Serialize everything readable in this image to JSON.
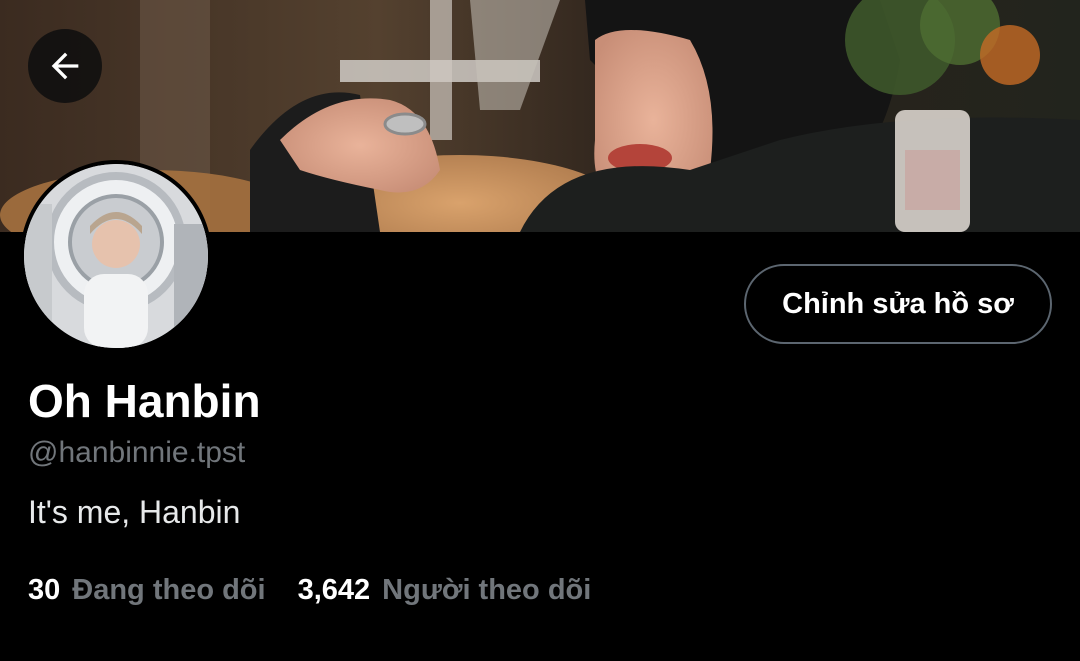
{
  "header": {
    "back_icon": "arrow-left-icon"
  },
  "profile": {
    "edit_label": "Chỉnh sửa hồ sơ",
    "display_name": "Oh Hanbin",
    "handle": "@hanbinnie.tpst",
    "bio": "It's me, Hanbin",
    "following_count": "30",
    "following_label": "Đang theo dõi",
    "followers_count": "3,642",
    "followers_label": "Người theo dõi"
  },
  "colors": {
    "background": "#000000",
    "secondary_text": "#71767b",
    "button_border": "#5c6670"
  }
}
